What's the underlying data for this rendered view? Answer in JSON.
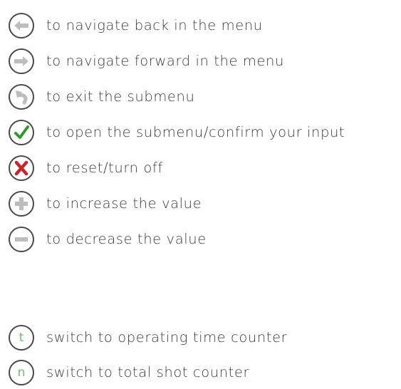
{
  "legend": {
    "items": [
      {
        "icon": "arrow-left-icon",
        "text": "to navigate back in the menu"
      },
      {
        "icon": "arrow-right-icon",
        "text": "to navigate forward in the menu"
      },
      {
        "icon": "return-icon",
        "text": "to exit the submenu"
      },
      {
        "icon": "checkmark-icon",
        "text": "to open the submenu/confirm your input"
      },
      {
        "icon": "cross-icon",
        "text": "to reset/turn off"
      },
      {
        "icon": "plus-icon",
        "text": "to increase the value"
      },
      {
        "icon": "minus-icon",
        "text": "to decrease the value"
      }
    ],
    "counter_items": [
      {
        "icon": "t-icon",
        "glyph": "t",
        "text": "switch to operating time counter"
      },
      {
        "icon": "n-icon",
        "glyph": "n",
        "text": "switch to total shot counter"
      }
    ]
  },
  "colors": {
    "text": "#3c3c3c",
    "icon_border": "#4a4a4a",
    "icon_gray": "#bdbdbd",
    "check_green": "#2e9a2c",
    "cross_red": "#c8242b",
    "glyph_green": "#6fbf6d"
  }
}
